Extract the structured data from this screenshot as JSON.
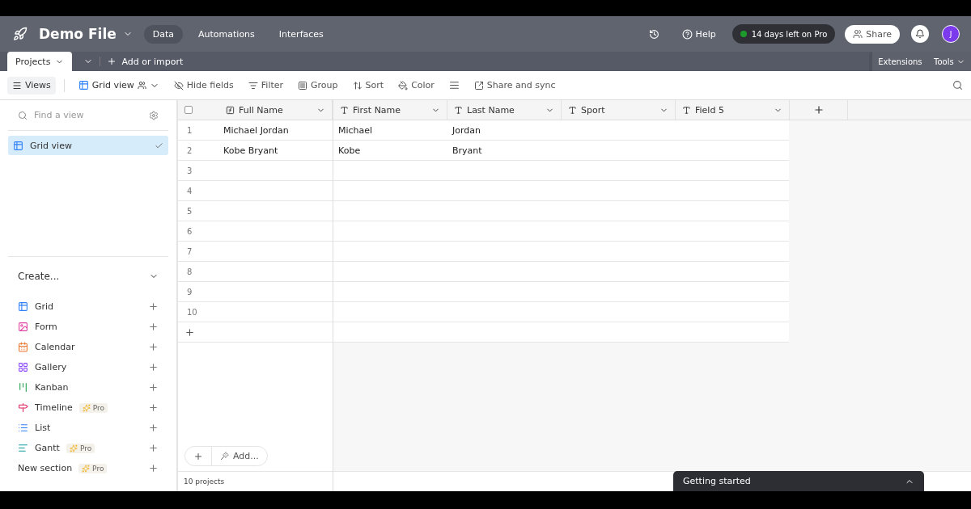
{
  "app": {
    "title": "Demo File",
    "nav": [
      {
        "label": "Data",
        "selected": true
      },
      {
        "label": "Automations",
        "selected": false
      },
      {
        "label": "Interfaces",
        "selected": false
      }
    ],
    "help": "Help",
    "trial": "14 days left on Pro",
    "share": "Share",
    "avatar": "J"
  },
  "table_tabs": [
    {
      "label": "Projects",
      "selected": true
    }
  ],
  "add_import": "Add or import",
  "extensions": "Extensions",
  "tools": "Tools",
  "toolbar": {
    "views": "Views",
    "view_name": "Grid view",
    "actions": [
      {
        "label": "Hide fields",
        "kind": "hide"
      },
      {
        "label": "Filter",
        "kind": "filter"
      },
      {
        "label": "Group",
        "kind": "group"
      },
      {
        "label": "Sort",
        "kind": "sort"
      },
      {
        "label": "Color",
        "kind": "color"
      },
      {
        "kind": "row-height"
      },
      {
        "label": "Share and sync",
        "kind": "share"
      }
    ]
  },
  "sidebar": {
    "search": {
      "placeholder": "Find a view"
    },
    "views": [
      {
        "label": "Grid view",
        "selected": true
      }
    ],
    "create": {
      "title": "Create...",
      "items": [
        {
          "label": "Grid",
          "kind": "grid"
        },
        {
          "label": "Form",
          "kind": "form"
        },
        {
          "label": "Calendar",
          "kind": "calendar"
        },
        {
          "label": "Gallery",
          "kind": "gallery"
        },
        {
          "label": "Kanban",
          "kind": "kanban"
        },
        {
          "label": "Timeline",
          "kind": "timeline",
          "badge": "Pro"
        },
        {
          "label": "List",
          "kind": "list"
        },
        {
          "label": "Gantt",
          "kind": "gantt",
          "badge": "Pro"
        }
      ]
    },
    "new_section": {
      "label": "New section",
      "badge": "Pro"
    }
  },
  "table": {
    "select_all": {
      "checked": false
    },
    "columns": [
      {
        "label": "Full Name",
        "kind": "formula"
      },
      {
        "label": "First Name",
        "kind": "text"
      },
      {
        "label": "Last Name",
        "kind": "text"
      },
      {
        "label": "Sport",
        "kind": "text"
      },
      {
        "label": "Field 5",
        "kind": "text"
      }
    ],
    "rows": [
      {
        "number": "1",
        "cells": [
          "Michael Jordan",
          "Michael",
          "Jordan"
        ]
      },
      {
        "number": "2",
        "cells": [
          "Kobe Bryant",
          "Kobe",
          "Bryant"
        ]
      },
      {
        "number": "3"
      },
      {
        "number": "4"
      },
      {
        "number": "5"
      },
      {
        "number": "6"
      },
      {
        "number": "7"
      },
      {
        "number": "8"
      },
      {
        "number": "9"
      },
      {
        "number": "10"
      }
    ]
  },
  "add_label": "Add...",
  "footer": "10 projects",
  "getting_started": "Getting started"
}
